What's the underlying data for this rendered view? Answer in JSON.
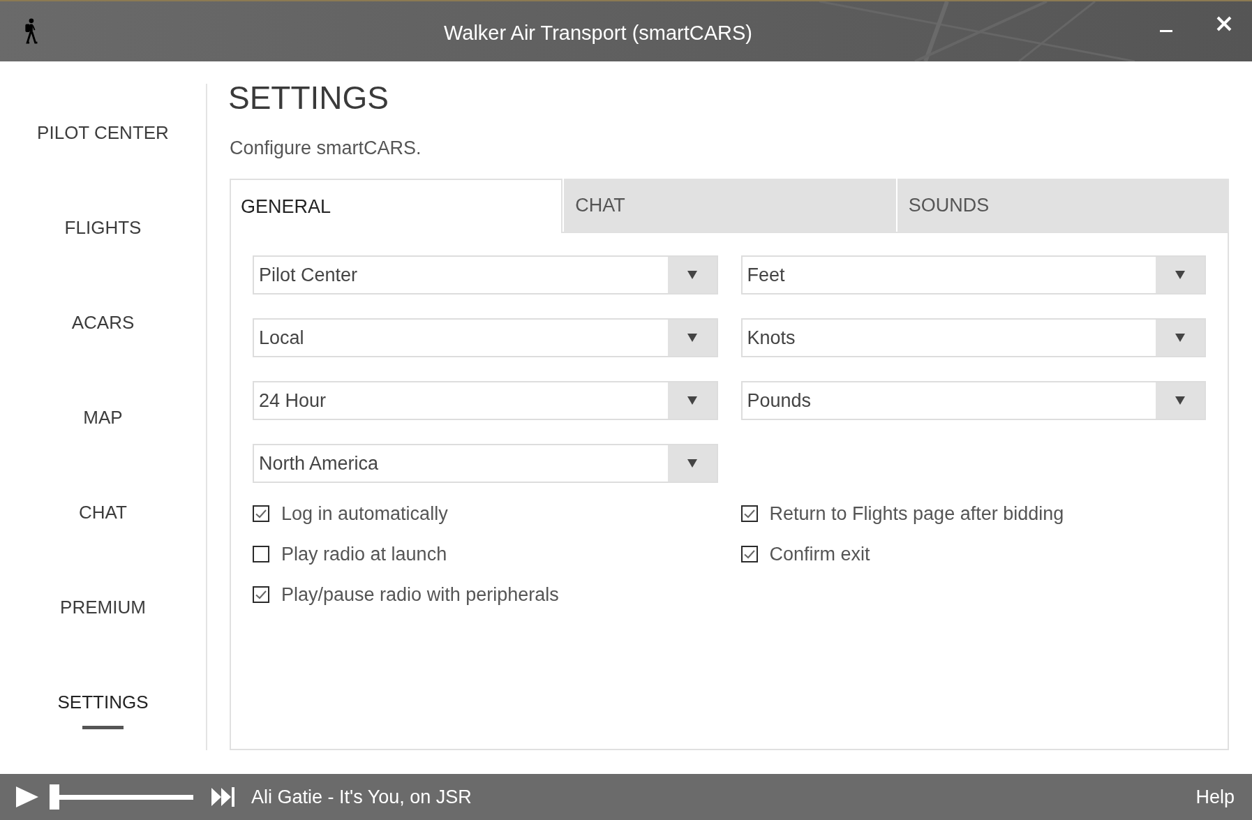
{
  "window": {
    "title": "Walker Air Transport (smartCARS)"
  },
  "sidebar": {
    "items": [
      {
        "label": "PILOT CENTER",
        "selected": false
      },
      {
        "label": "FLIGHTS",
        "selected": false
      },
      {
        "label": "ACARS",
        "selected": false
      },
      {
        "label": "MAP",
        "selected": false
      },
      {
        "label": "CHAT",
        "selected": false
      },
      {
        "label": "PREMIUM",
        "selected": false
      },
      {
        "label": "SETTINGS",
        "selected": true
      }
    ]
  },
  "page": {
    "title": "SETTINGS",
    "subtitle": "Configure smartCARS."
  },
  "tabs": [
    {
      "label": "GENERAL",
      "selected": true
    },
    {
      "label": "CHAT",
      "selected": false
    },
    {
      "label": "SOUNDS",
      "selected": false
    }
  ],
  "general": {
    "dropdown_columns": [
      {
        "items": [
          {
            "value": "Pilot Center"
          },
          {
            "value": "Local"
          },
          {
            "value": "24 Hour"
          },
          {
            "value": "North America"
          }
        ]
      },
      {
        "items": [
          {
            "value": "Feet"
          },
          {
            "value": "Knots"
          },
          {
            "value": "Pounds"
          }
        ]
      }
    ],
    "checkbox_columns": [
      {
        "items": [
          {
            "label": "Log in automatically",
            "checked": true
          },
          {
            "label": "Play radio at launch",
            "checked": false
          },
          {
            "label": "Play/pause radio with peripherals",
            "checked": true
          }
        ]
      },
      {
        "items": [
          {
            "label": "Return to Flights page after bidding",
            "checked": true
          },
          {
            "label": "Confirm exit",
            "checked": true
          }
        ]
      }
    ]
  },
  "player": {
    "track": "Ali Gatie - It's You, on JSR",
    "level": 0
  },
  "status_bar": {
    "help": "Help"
  }
}
